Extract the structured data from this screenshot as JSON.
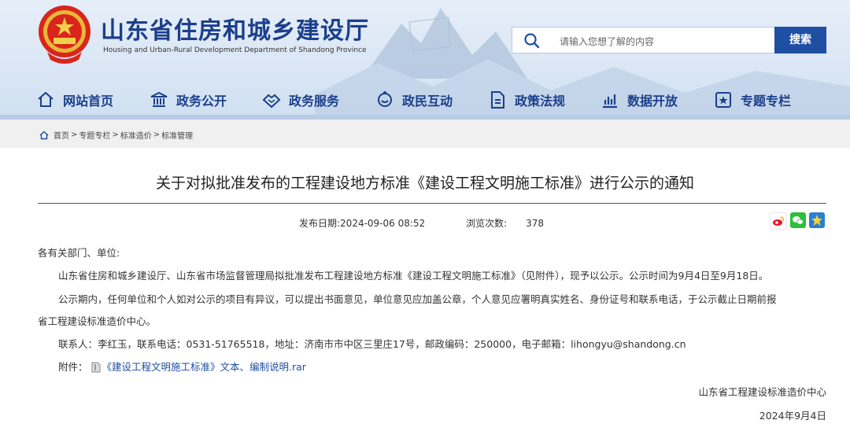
{
  "header": {
    "title": "山东省住房和城乡建设厅",
    "subtitle": "Housing and Urban-Rural Development Department of Shandong Province",
    "search_placeholder": "请输入您想了解的内容",
    "search_button": "搜索"
  },
  "nav": [
    {
      "label": "网站首页",
      "icon": "home-icon"
    },
    {
      "label": "政务公开",
      "icon": "government-building-icon"
    },
    {
      "label": "政务服务",
      "icon": "handshake-icon"
    },
    {
      "label": "政民互动",
      "icon": "interaction-icon"
    },
    {
      "label": "政策法规",
      "icon": "document-icon"
    },
    {
      "label": "数据开放",
      "icon": "chart-icon"
    },
    {
      "label": "专题专栏",
      "icon": "special-topic-icon"
    }
  ],
  "breadcrumb": {
    "items": [
      "首页",
      "专题专栏",
      "标准造价",
      "标准管理"
    ],
    "separator": ">"
  },
  "article": {
    "title": "关于对拟批准发布的工程建设地方标准《建设工程文明施工标准》进行公示的通知",
    "publish_label": "发布日期:",
    "publish_date": "2024-09-06 08:52",
    "views_label": "浏览次数:",
    "views": "378",
    "salutation": "各有关部门、单位:",
    "para1": "山东省住房和城乡建设厅、山东省市场监督管理局拟批准发布工程建设地方标准《建设工程文明施工标准》（见附件），现予以公示。公示时间为9月4日至9月18日。",
    "para2_line1": "公示期内，任何单位和个人如对公示的项目有异议，可以提出书面意见，单位意见应加盖公章，个人意见应署明真实姓名、身份证号和联系电话，于公示截止日期前报",
    "para2_line2": "省工程建设标准造价中心。",
    "contact": "联系人：李红玉，联系电话：0531-51765518，地址：济南市市中区三里庄17号，邮政编码：250000，电子邮箱：lihongyu@shandong.cn",
    "attachment_label": "附件：",
    "attachment_link": "《建设工程文明施工标准》文本、编制说明.rar",
    "signature_org": "山东省工程建设标准造价中心",
    "signature_date": "2024年9月4日"
  },
  "share": [
    "weibo-icon",
    "wechat-icon",
    "favorite-icon"
  ],
  "colors": {
    "brand": "#1b3f8b",
    "button": "#1e4fa3",
    "link": "#1e4fa3"
  }
}
